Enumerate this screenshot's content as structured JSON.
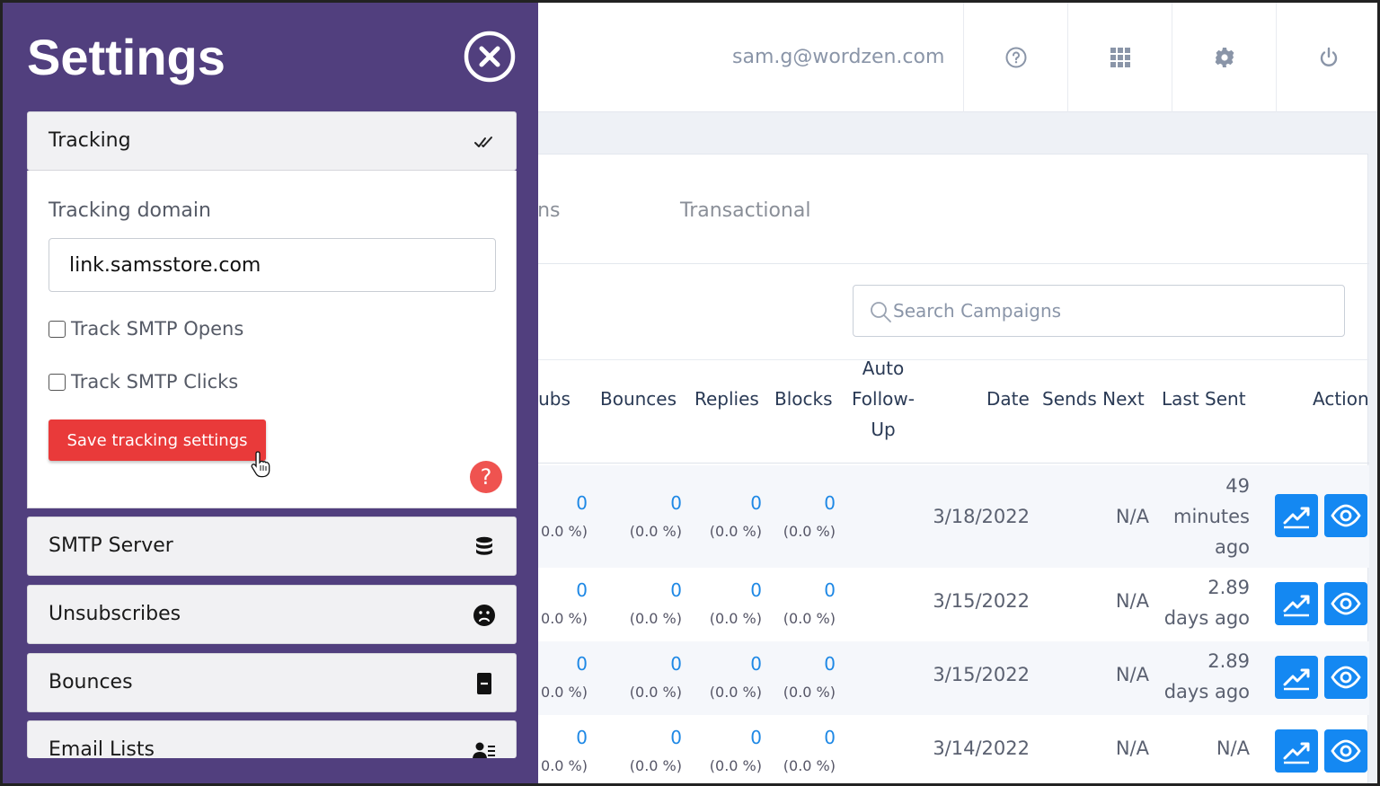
{
  "header": {
    "user_email": "sam.g@wordzen.com",
    "icons": [
      "help-circle-icon",
      "apps-grid-icon",
      "gear-icon",
      "power-icon"
    ]
  },
  "tabs": [
    "...igns",
    "Transactional"
  ],
  "tab_partial": "igns",
  "tab_transactional": "Transactional",
  "search": {
    "placeholder": "Search Campaigns"
  },
  "table": {
    "headers": {
      "unsubs": "nsubs",
      "bounces": "Bounces",
      "replies": "Replies",
      "blocks": "Blocks",
      "auto1": "Auto",
      "auto2": "Follow-",
      "auto3": "Up",
      "date": "Date",
      "sends_next": "Sends Next",
      "last_sent": "Last Sent",
      "actions": "Action"
    },
    "rows": [
      {
        "unsubs": "0",
        "unsubs_pct": "0.0 %)",
        "bounces": "0",
        "bounces_pct": "(0.0 %)",
        "replies": "0",
        "replies_pct": "(0.0 %)",
        "blocks": "0",
        "blocks_pct": "(0.0 %)",
        "date": "3/18/2022",
        "sends_next": "N/A",
        "last1": "49",
        "last2": "minutes",
        "last3": "ago"
      },
      {
        "unsubs": "0",
        "unsubs_pct": "0.0 %)",
        "bounces": "0",
        "bounces_pct": "(0.0 %)",
        "replies": "0",
        "replies_pct": "(0.0 %)",
        "blocks": "0",
        "blocks_pct": "(0.0 %)",
        "date": "3/15/2022",
        "sends_next": "N/A",
        "last1": "2.89",
        "last2": "days ago",
        "last3": ""
      },
      {
        "unsubs": "0",
        "unsubs_pct": "0.0 %)",
        "bounces": "0",
        "bounces_pct": "(0.0 %)",
        "replies": "0",
        "replies_pct": "(0.0 %)",
        "blocks": "0",
        "blocks_pct": "(0.0 %)",
        "date": "3/15/2022",
        "sends_next": "N/A",
        "last1": "2.89",
        "last2": "days ago",
        "last3": ""
      },
      {
        "unsubs": "0",
        "unsubs_pct": "0.0 %)",
        "bounces": "0",
        "bounces_pct": "(0.0 %)",
        "replies": "0",
        "replies_pct": "(0.0 %)",
        "blocks": "0",
        "blocks_pct": "(0.0 %)",
        "date": "3/14/2022",
        "sends_next": "N/A",
        "last1": "N/A",
        "last2": "",
        "last3": ""
      }
    ]
  },
  "settings": {
    "title": "Settings",
    "sections": {
      "tracking": "Tracking",
      "smtp": "SMTP Server",
      "unsubscribes": "Unsubscribes",
      "bounces": "Bounces",
      "email_lists": "Email Lists"
    },
    "tracking_domain_label": "Tracking domain",
    "tracking_domain_value": "link.samsstore.com",
    "track_opens_label": "Track SMTP Opens",
    "track_clicks_label": "Track SMTP Clicks",
    "track_opens_checked": false,
    "track_clicks_checked": false,
    "save_label": "Save tracking settings",
    "help_label": "?"
  },
  "colors": {
    "panel": "#513f7e",
    "save_button": "#e93a3a",
    "action_button": "#1488f2",
    "link_number": "#1e88e5"
  }
}
